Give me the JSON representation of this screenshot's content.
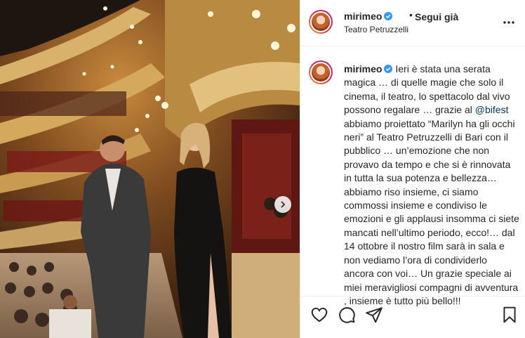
{
  "post": {
    "username": "mirimeo",
    "follow_label": "Segui già",
    "location": "Teatro Petruzzelli",
    "caption_before_mention": "Ieri è stata una serata magica … di quelle magie che solo il cinema, il teatro, lo spettacolo dal vivo possono regalare … grazie al ",
    "mention": "@bifest",
    "caption_after_mention": " abbiamo proiettato “Marilyn ha gli occhi neri” al Teatro Petruzzelli di Bari con il pubblico … un’emozione che non provavo da tempo e che si è rinnovata in tutta la sua potenza e bellezza… abbiamo riso insieme, ci siamo commossi insieme e condiviso le emozioni e gli applausi insomma ci siete mancati nell’ultimo periodo, ecco!… dal 14 ottobre il nostro film sarà in sala e non vediamo l’ora di condividerlo ancora con voi… Un grazie speciale ai miei meravigliosi compagni di avventura , insieme è tutto più bello!!!"
  },
  "icons": {
    "more": "more-options-icon",
    "next": "chevron-right-icon",
    "like": "heart-icon",
    "comment": "comment-icon",
    "share": "paper-plane-icon",
    "save": "bookmark-icon",
    "verified": "verified-badge-icon"
  },
  "colors": {
    "verified": "#3897f0",
    "mention": "#00376b",
    "text": "#262626"
  }
}
